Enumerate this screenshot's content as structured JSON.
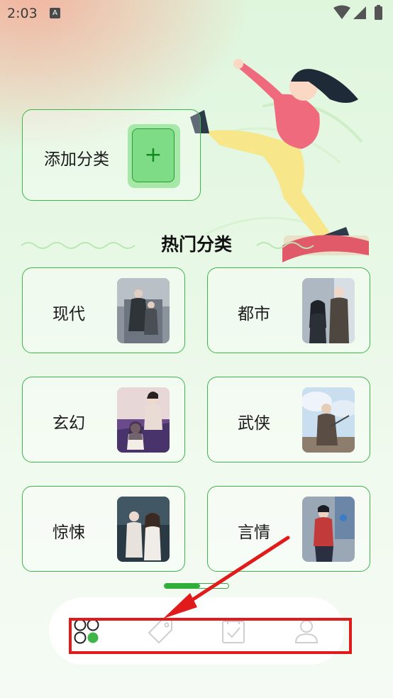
{
  "status_bar": {
    "time": "2:03",
    "notification_letter": "A"
  },
  "add_category": {
    "label": "添加分类",
    "button_symbol": "+"
  },
  "hot_section": {
    "title": "热门分类"
  },
  "categories": [
    {
      "label": "现代",
      "cover": "modern-cover"
    },
    {
      "label": "都市",
      "cover": "urban-cover"
    },
    {
      "label": "玄幻",
      "cover": "fantasy-cover"
    },
    {
      "label": "武侠",
      "cover": "martial-arts-cover"
    },
    {
      "label": "惊悚",
      "cover": "thriller-cover"
    },
    {
      "label": "言情",
      "cover": "romance-cover"
    }
  ],
  "page_indicator": {
    "progress": 0.55
  },
  "bottom_nav": {
    "items": [
      {
        "icon": "category-grid-icon",
        "active": true
      },
      {
        "icon": "tag-icon",
        "active": false
      },
      {
        "icon": "checklist-icon",
        "active": false
      },
      {
        "icon": "profile-icon",
        "active": false
      }
    ]
  },
  "colors": {
    "accent": "#3fb54a",
    "annotation": "#e11b1b"
  }
}
